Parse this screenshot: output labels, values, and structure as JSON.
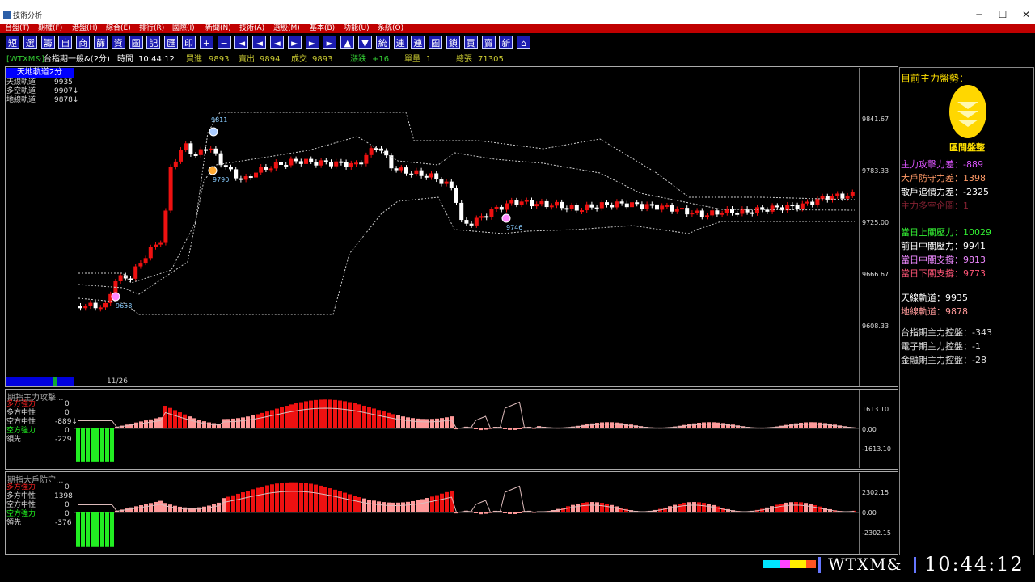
{
  "window": {
    "title": "技術分析",
    "controls": [
      "─",
      "☐",
      "✕"
    ]
  },
  "menu": [
    "台盤(T)",
    "期權(F)",
    "港盤(H)",
    "綜合(E)",
    "排行(R)",
    "國際(I)",
    "新聞(N)",
    "技術(A)",
    "選股(M)",
    "基本(B)",
    "功能(U)",
    "系統(O)"
  ],
  "toolbar": [
    "短",
    "選",
    "籌",
    "自",
    "商",
    "篩",
    "資",
    "圖",
    "記",
    "匯",
    "印",
    "+",
    "−",
    "◄",
    "◄",
    "◄",
    "►",
    "►",
    "►",
    "▲",
    "▼",
    "統",
    "連",
    "連",
    "圖",
    "鎖",
    "買",
    "賣",
    "新",
    "⌂"
  ],
  "quote": {
    "symbol": "[WTXM&]",
    "name": "台指期一般&(2分)",
    "time_label": "時間",
    "time": "10:44:12",
    "bid_label": "買進",
    "bid": "9893",
    "ask_label": "賣出",
    "ask": "9894",
    "last_label": "成交",
    "last": "9893",
    "change_label": "漲跌",
    "change": "+16",
    "vol_label": "單量",
    "vol": "1",
    "total_label": "總張",
    "total": "71305"
  },
  "legend": {
    "title": "天地軌道2分",
    "rows": [
      {
        "label": "天線軌道",
        "value": "9935",
        "color": "#ffffff"
      },
      {
        "label": "多空軌道",
        "value": "9907↓",
        "color": "#ffffff"
      },
      {
        "label": "地線軌道",
        "value": "9878↓",
        "color": "#ffffff"
      }
    ]
  },
  "main_chart": {
    "date": "11/26",
    "y_ticks": [
      "9841.67",
      "9783.33",
      "9725.00",
      "9666.67",
      "9608.33"
    ],
    "markers": [
      "9811",
      "9790",
      "9746",
      "9658"
    ]
  },
  "sub1": {
    "title": "期指主力攻擊...",
    "rows": [
      {
        "label": "多方強力",
        "value": "0",
        "color": "#ff2222"
      },
      {
        "label": "多方中性",
        "value": "0",
        "color": "#ffffff"
      },
      {
        "label": "空方中性",
        "value": "-889↓",
        "color": "#ffffff"
      },
      {
        "label": "空方強力",
        "value": "0",
        "color": "#22ff22"
      },
      {
        "label": "領先",
        "value": "-229",
        "color": "#ffffff"
      }
    ],
    "y_ticks": [
      "1613.10",
      "0.00",
      "-1613.10"
    ]
  },
  "sub2": {
    "title": "期指大戶防守...",
    "rows": [
      {
        "label": "多方強力",
        "value": "0",
        "color": "#ff2222"
      },
      {
        "label": "多方中性",
        "value": "1398",
        "color": "#ffffff"
      },
      {
        "label": "空方中性",
        "value": "0",
        "color": "#ffffff"
      },
      {
        "label": "空方強力",
        "value": "0",
        "color": "#22ff22"
      },
      {
        "label": "領先",
        "value": "-376",
        "color": "#ffffff"
      }
    ],
    "y_ticks": [
      "2302.15",
      "0.00",
      "-2302.15"
    ]
  },
  "right_panel": {
    "heading": "目前主力盤勢：",
    "badge": "區間盤整",
    "group1": [
      {
        "label": "主力攻擊力差：",
        "value": "-889",
        "color": "#dd55ff"
      },
      {
        "label": "大戶防守力差：",
        "value": "1398",
        "color": "#ff9966"
      },
      {
        "label": "散戶追價力差：",
        "value": "-2325",
        "color": "#ffffff"
      },
      {
        "label": "主力多空企圖：",
        "value": "1",
        "color": "#882233"
      }
    ],
    "group2": [
      {
        "label": "當日上關壓力：",
        "value": "10029",
        "color": "#33ee33"
      },
      {
        "label": "前日中關壓力：",
        "value": "9941",
        "color": "#ffffff"
      },
      {
        "label": "當日中關支撐：",
        "value": "9813",
        "color": "#ee88ff"
      },
      {
        "label": "當日下關支撐：",
        "value": "9773",
        "color": "#ff5577"
      }
    ],
    "group3": [
      {
        "label": "天線軌道：",
        "value": "9935",
        "color": "#ffffff"
      },
      {
        "label": "地線軌道：",
        "value": "9878",
        "color": "#ff9999"
      }
    ],
    "group4": [
      {
        "label": "台指期主力控盤：",
        "value": "-343",
        "color": "#ffffff"
      },
      {
        "label": "電子期主力控盤：",
        "value": "-1",
        "color": "#ffffff"
      },
      {
        "label": "金融期主力控盤：",
        "value": "-28",
        "color": "#ffffff"
      }
    ]
  },
  "status": {
    "symbol": "WTXM&",
    "time": "10:44:12"
  },
  "colors": {
    "up": "#ee1111",
    "down": "#ffffff",
    "bull_bar": "#ee1111",
    "bear_bar": "#22dd22",
    "menu_bg": "#c00000"
  }
}
